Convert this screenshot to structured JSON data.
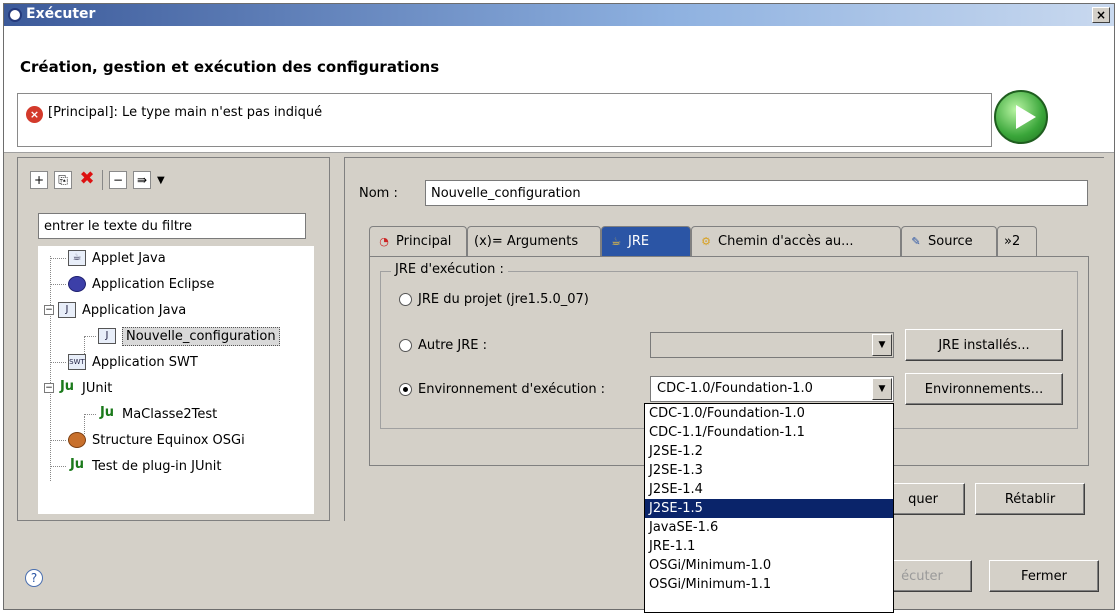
{
  "window": {
    "title": "Exécuter",
    "close_label": "×"
  },
  "header": {
    "heading": "Création, gestion et exécution des configurations",
    "message": "[Principal]: Le type main n'est pas indiqué"
  },
  "left": {
    "filter_value": "entrer le texte du filtre",
    "tree": [
      {
        "label": "Applet Java",
        "icon": "applet-icon"
      },
      {
        "label": "Application Eclipse",
        "icon": "eclipse-icon"
      },
      {
        "label": "Application Java",
        "icon": "java-app-icon",
        "expanded": true
      },
      {
        "label": "Nouvelle_configuration",
        "icon": "java-config-icon",
        "selected": true
      },
      {
        "label": "Application SWT",
        "icon": "swt-icon"
      },
      {
        "label": "JUnit",
        "icon": "junit-icon",
        "expanded": true
      },
      {
        "label": "MaClasse2Test",
        "icon": "junit-test-icon"
      },
      {
        "label": "Structure Equinox OSGi",
        "icon": "osgi-icon"
      },
      {
        "label": "Test de plug-in JUnit",
        "icon": "plugin-junit-icon"
      }
    ]
  },
  "right": {
    "name_label": "Nom :",
    "name_value": "Nouvelle_configuration",
    "tabs": [
      {
        "label": "Principal"
      },
      {
        "label": "(x)= Arguments"
      },
      {
        "label": "JRE"
      },
      {
        "label": "Chemin d'accès au..."
      },
      {
        "label": "Source"
      },
      {
        "label": "»2"
      }
    ],
    "jre_group_title": "JRE d'exécution :",
    "opt_project_jre": "JRE du projet (jre1.5.0_07)",
    "opt_other_jre": "Autre JRE :",
    "opt_exec_env": "Environnement d'exécution :",
    "btn_installed_jres": "JRE installés...",
    "btn_environments": "Environnements...",
    "exec_env_value": "CDC-1.0/Foundation-1.0",
    "btn_apply": "quer",
    "btn_revert": "Rétablir"
  },
  "dropdown": {
    "options": [
      "CDC-1.0/Foundation-1.0",
      "CDC-1.1/Foundation-1.1",
      "J2SE-1.2",
      "J2SE-1.3",
      "J2SE-1.4",
      "J2SE-1.5",
      "JavaSE-1.6",
      "JRE-1.1",
      "OSGi/Minimum-1.0",
      "OSGi/Minimum-1.1"
    ],
    "selected_index": 5
  },
  "footer": {
    "btn_run": "écuter",
    "btn_close": "Fermer",
    "help": "?"
  }
}
